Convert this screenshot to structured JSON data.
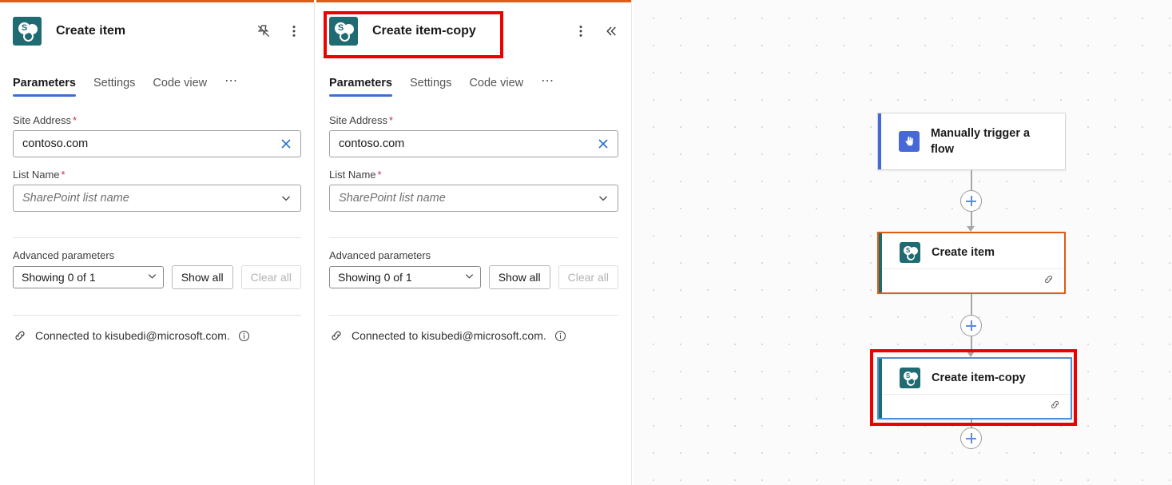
{
  "theme": {
    "accent_orange": "#e05c12",
    "accent_blue": "#3b6fd4",
    "sharepoint_teal": "#1f6b72",
    "trigger_blue": "#4668d9",
    "annotation_red": "#ee0000",
    "required_red": "#c4314b",
    "canvas_bg": "#fbfbfb"
  },
  "panels": [
    {
      "id": "create-item",
      "title": "Create item",
      "icon": "sharepoint-icon",
      "actions": [
        "unpin-icon",
        "more-options-icon"
      ],
      "tabs": [
        {
          "label": "Parameters",
          "active": true
        },
        {
          "label": "Settings",
          "active": false
        },
        {
          "label": "Code view",
          "active": false
        }
      ],
      "tab_overflow_label": "⋯",
      "fields": [
        {
          "label": "Site Address",
          "required": true,
          "value": "contoso.com",
          "placeholder": "",
          "affix": "clear-icon"
        },
        {
          "label": "List Name",
          "required": true,
          "value": "",
          "placeholder": "SharePoint list name",
          "affix": "chevron-down-icon"
        }
      ],
      "advanced": {
        "label": "Advanced parameters",
        "select_value": "Showing 0 of 1",
        "show_all_label": "Show all",
        "clear_all_label": "Clear all",
        "clear_all_disabled": true
      },
      "connection": {
        "text": "Connected to kisubedi@microsoft.com.",
        "link_icon": "link-icon",
        "info_icon": "info-icon"
      }
    },
    {
      "id": "create-item-copy",
      "title": "Create item-copy",
      "icon": "sharepoint-icon",
      "actions": [
        "more-options-icon",
        "collapse-icon"
      ],
      "tabs": [
        {
          "label": "Parameters",
          "active": true
        },
        {
          "label": "Settings",
          "active": false
        },
        {
          "label": "Code view",
          "active": false
        }
      ],
      "tab_overflow_label": "⋯",
      "fields": [
        {
          "label": "Site Address",
          "required": true,
          "value": "contoso.com",
          "placeholder": "",
          "affix": "clear-icon"
        },
        {
          "label": "List Name",
          "required": true,
          "value": "",
          "placeholder": "SharePoint list name",
          "affix": "chevron-down-icon"
        }
      ],
      "advanced": {
        "label": "Advanced parameters",
        "select_value": "Showing 0 of 1",
        "show_all_label": "Show all",
        "clear_all_label": "Clear all",
        "clear_all_disabled": true
      },
      "connection": {
        "text": "Connected to kisubedi@microsoft.com.",
        "link_icon": "link-icon",
        "info_icon": "info-icon"
      }
    }
  ],
  "canvas": {
    "nodes": [
      {
        "id": "manually-trigger-a-flow",
        "label": "Manually trigger a flow",
        "icon": "hand-pointer-icon",
        "accent_color": "#4668d9",
        "selected": false,
        "has_footer": false
      },
      {
        "id": "create-item",
        "label": "Create item",
        "icon": "sharepoint-icon",
        "accent_color": "#1f6b72",
        "selected": true,
        "selection_color": "#e05c12",
        "has_footer": true,
        "footer_icon": "link-icon"
      },
      {
        "id": "create-item-copy",
        "label": "Create item-copy",
        "icon": "sharepoint-icon",
        "accent_color": "#1f6b72",
        "selected": true,
        "selection_color": "#4d8fd6",
        "has_footer": true,
        "footer_icon": "link-icon"
      }
    ],
    "add_buttons": 3,
    "add_button_label": "+"
  },
  "annotations": [
    {
      "id": "panel-title-highlight",
      "target": "create-item-copy-panel-header"
    },
    {
      "id": "canvas-node-highlight",
      "target": "create-item-copy-node"
    }
  ]
}
